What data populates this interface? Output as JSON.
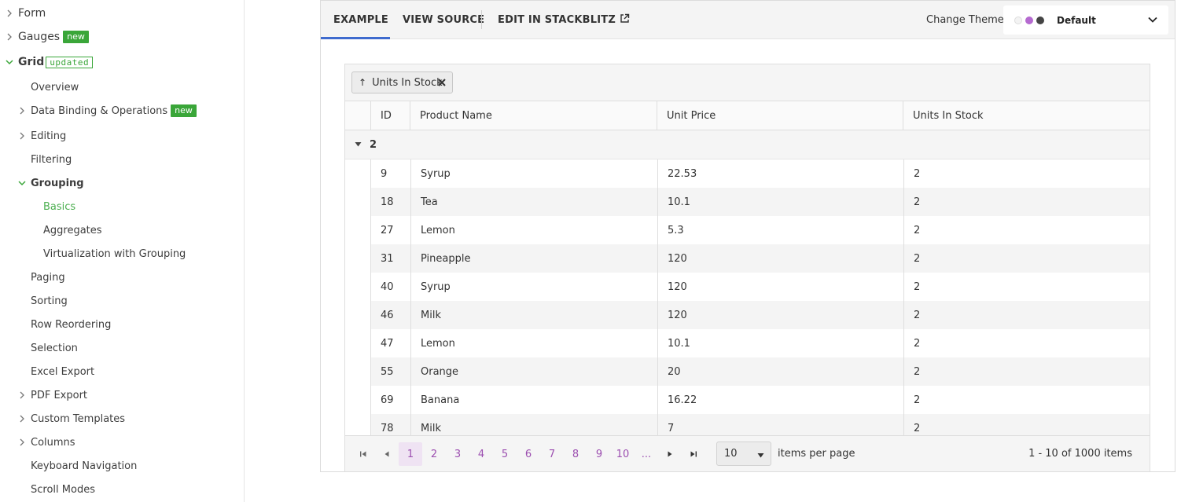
{
  "sidebar": {
    "items": [
      {
        "label": "Form",
        "chevron": "right",
        "top": true
      },
      {
        "label": "Gauges",
        "chevron": "right",
        "top": true,
        "badge": "new"
      },
      {
        "label": "Grid",
        "chevron": "down",
        "top": true,
        "badge_updated": "updated"
      },
      {
        "label": "Overview"
      },
      {
        "label": "Data Binding & Operations",
        "chevron": "right",
        "badge": "new"
      },
      {
        "label": "Editing",
        "chevron": "right"
      },
      {
        "label": "Filtering"
      },
      {
        "label": "Grouping",
        "chevron": "down"
      },
      {
        "label": "Basics",
        "active": true
      },
      {
        "label": "Aggregates"
      },
      {
        "label": "Virtualization with Grouping"
      },
      {
        "label": "Paging"
      },
      {
        "label": "Sorting"
      },
      {
        "label": "Row Reordering"
      },
      {
        "label": "Selection"
      },
      {
        "label": "Excel Export"
      },
      {
        "label": "PDF Export",
        "chevron": "right"
      },
      {
        "label": "Custom Templates",
        "chevron": "right"
      },
      {
        "label": "Columns",
        "chevron": "right"
      },
      {
        "label": "Keyboard Navigation"
      },
      {
        "label": "Scroll Modes"
      }
    ]
  },
  "toolbar": {
    "tab_example": "EXAMPLE",
    "tab_view_source": "VIEW SOURCE",
    "tab_edit_stackblitz": "EDIT IN STACKBLITZ",
    "theme_label": "Change Theme:",
    "theme_value": "Default",
    "theme_swatches": [
      "#f3f3f3",
      "#b56ad0",
      "#444444"
    ]
  },
  "grid": {
    "group_chip": {
      "arrow": "↑",
      "label": "Units In Stock"
    },
    "columns": [
      "ID",
      "Product Name",
      "Unit Price",
      "Units In Stock"
    ],
    "group_value": "2",
    "rows": [
      [
        "9",
        "Syrup",
        "22.53",
        "2"
      ],
      [
        "18",
        "Tea",
        "10.1",
        "2"
      ],
      [
        "27",
        "Lemon",
        "5.3",
        "2"
      ],
      [
        "31",
        "Pineapple",
        "120",
        "2"
      ],
      [
        "40",
        "Syrup",
        "120",
        "2"
      ],
      [
        "46",
        "Milk",
        "120",
        "2"
      ],
      [
        "47",
        "Lemon",
        "10.1",
        "2"
      ],
      [
        "55",
        "Orange",
        "20",
        "2"
      ],
      [
        "69",
        "Banana",
        "16.22",
        "2"
      ],
      [
        "78",
        "Milk",
        "7",
        "2"
      ]
    ]
  },
  "pager": {
    "pages": [
      "1",
      "2",
      "3",
      "4",
      "5",
      "6",
      "7",
      "8",
      "9",
      "10",
      "..."
    ],
    "current_page": "1",
    "page_size": "10",
    "items_per_page_label": "items per page",
    "info": "1 - 10 of 1000 items"
  },
  "colors": {
    "accent_green": "#3aa639",
    "tab_underline": "#3f6bce",
    "pager_link": "#9c4fb0",
    "pager_selected_bg": "#efe3f3"
  }
}
